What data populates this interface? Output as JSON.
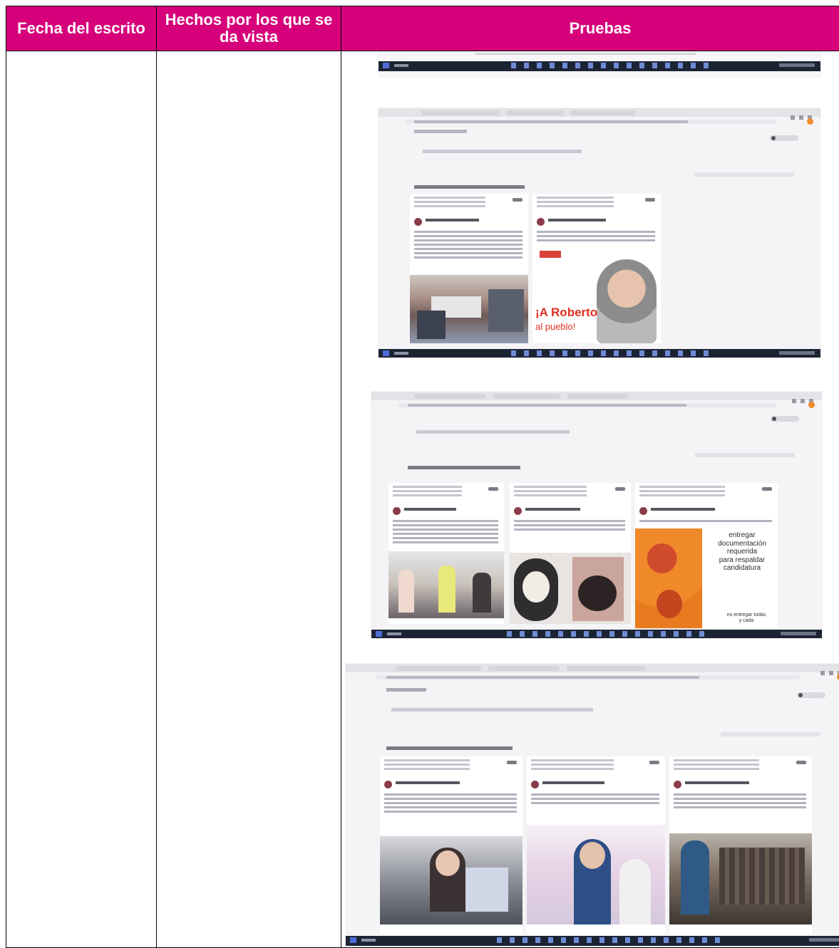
{
  "table": {
    "headers": {
      "fecha": "Fecha del escrito",
      "hechos": "Hechos por los que se da vista",
      "pruebas": "Pruebas"
    },
    "header_bg_color": "#d6007a",
    "header_text_color": "#ffffff"
  },
  "evidence": {
    "screenshot2": {
      "promo_title": "¡A Roberto",
      "promo_subtitle": "al pueblo!"
    },
    "screenshot3": {
      "poster_lines": [
        "entregar",
        "documentación",
        "requerida",
        "para respaldar",
        "candidatura"
      ],
      "poster_small": "no entregar todas y cada"
    }
  },
  "colors": {
    "promo_red": "#e0301e",
    "taskbar": "#1c2434",
    "poster_orange": "#f0892a"
  }
}
